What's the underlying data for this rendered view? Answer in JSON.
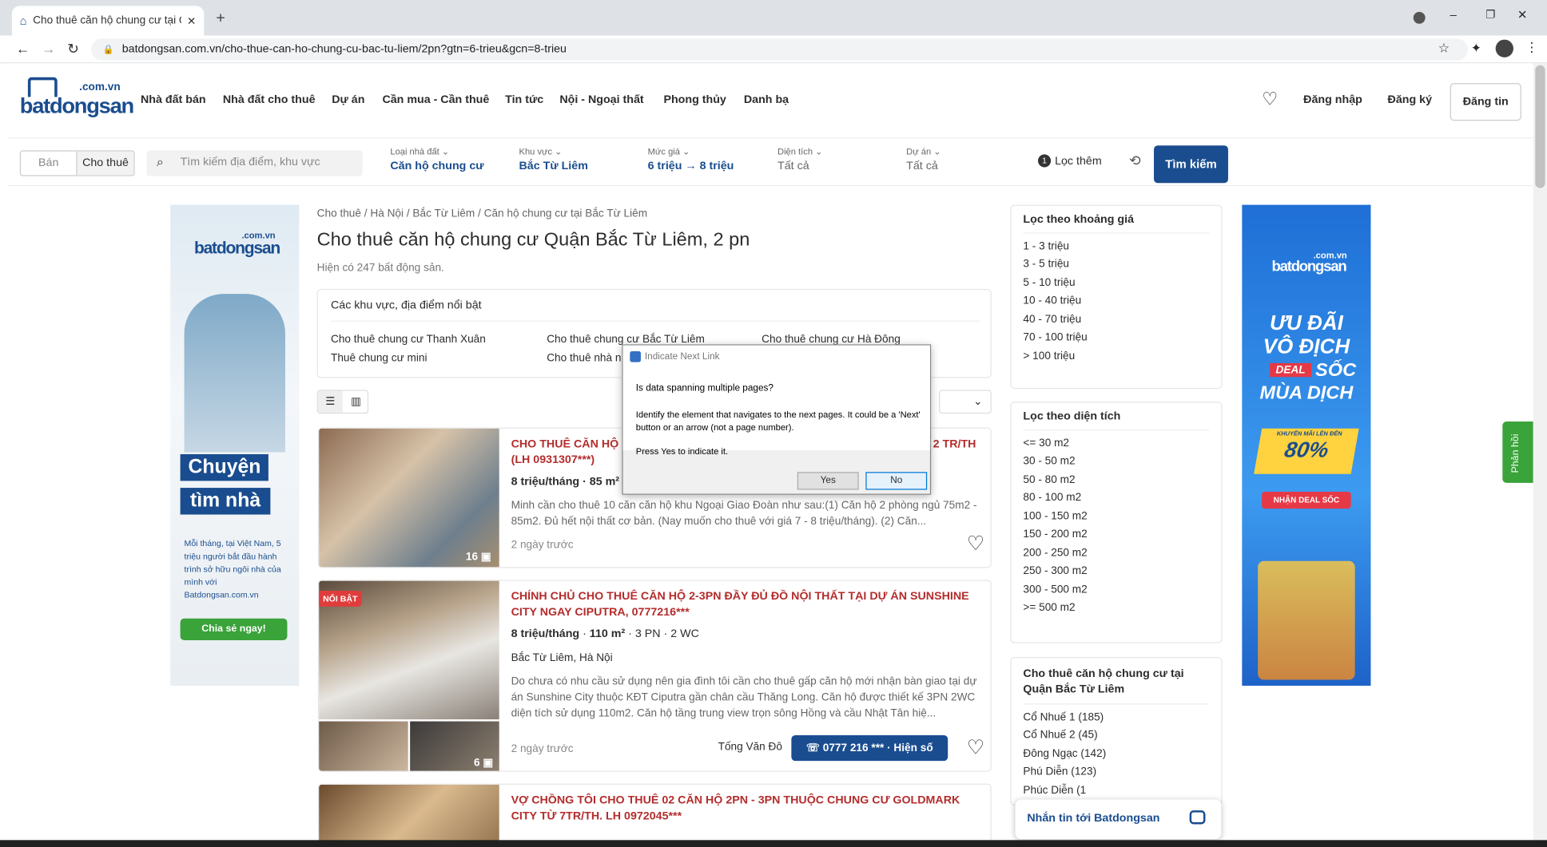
{
  "browser": {
    "tab_title": "Cho thuê căn hộ chung cư tại Qu",
    "url": "batdongsan.com.vn/cho-thue-can-ho-chung-cu-bac-tu-liem/2pn?gtn=6-trieu&gcn=8-trieu"
  },
  "logo": {
    "top": ".com.vn",
    "main": "batdongsan"
  },
  "nav": {
    "items": [
      "Nhà đất bán",
      "Nhà đất cho thuê",
      "Dự án",
      "Cần mua - Cần thuê",
      "Tin tức",
      "Nội - Ngoại thất",
      "Phong thủy",
      "Danh bạ"
    ],
    "login": "Đăng nhập",
    "register": "Đăng ký",
    "post": "Đăng tin"
  },
  "filter": {
    "sell": "Bán",
    "rent": "Cho thuê",
    "search_placeholder": "Tìm kiếm địa điểm, khu vực",
    "type_label": "Loại nhà đất",
    "type_value": "Căn hộ chung cư",
    "area_label": "Khu vực",
    "area_value": "Bắc Từ Liêm",
    "price_label": "Mức giá",
    "price_from": "6 triệu",
    "price_to": "8 triệu",
    "size_label": "Diện tích",
    "size_value": "Tất cả",
    "project_label": "Dự án",
    "project_value": "Tất cả",
    "more_count": "1",
    "more": "Lọc thêm",
    "search": "Tìm kiếm"
  },
  "breadcrumb": [
    "Cho thuê",
    "Hà Nội",
    "Bắc Từ Liêm",
    "Căn hộ chung cư tại Bắc Từ Liêm"
  ],
  "page_title": "Cho thuê căn hộ chung cư Quận Bắc Từ Liêm, 2 pn",
  "result_count": "Hiện có 247 bất động sản.",
  "featured": {
    "heading": "Các khu vực, địa điểm nổi bật",
    "links": [
      "Cho thuê chung cư Thanh Xuân",
      "Cho thuê chung cư Bắc Từ Liêm",
      "Cho thuê chung cư Hà Đông",
      "Thuê chung cư mini",
      "Cho thuê nhà n"
    ]
  },
  "left_ad": {
    "top": ".com.vn",
    "main": "batdongsan",
    "line1": "Chuyện",
    "line2": "tìm nhà",
    "body": "Mỗi tháng, tại Việt Nam, 5 triệu người bắt đầu hành trình sở hữu ngôi nhà của mình với Batdongsan.com.vn",
    "cta": "Chia sẻ ngay!"
  },
  "listings": [
    {
      "title": "CHO THUÊ CĂN HỘ DU",
      "title_tail": "2 TR/TH",
      "title2": "(LH 0931307***)",
      "price": "8 triệu/tháng",
      "area": "85 m²",
      "desc": "Minh cần cho thuê 10 căn căn hộ khu Ngoại Giao Đoàn như sau:(1) Căn hộ 2 phòng ngủ 75m2 - 85m2. Đủ hết nội thất cơ bản. (Nay muốn cho thuê với giá 7 - 8 triệu/tháng). (2) Căn...",
      "time": "2 ngày trước",
      "photos": "16"
    },
    {
      "badge": "NỔI BẬT",
      "title": "CHÍNH CHỦ CHO THUÊ CĂN HỘ 2-3PN ĐẦY ĐỦ ĐỒ NỘI THẤT TẠI DỰ ÁN SUNSHINE CITY NGAY CIPUTRA, 0777216***",
      "price": "8 triệu/tháng",
      "area": "110 m²",
      "beds": "3 PN",
      "baths": "2 WC",
      "location": "Bắc Từ Liêm, Hà Nội",
      "desc": "Do chưa có nhu cầu sử dụng nên gia đình tôi cần cho thuê gấp căn hộ mới nhận bàn giao tại dự án Sunshine City thuộc KĐT Ciputra gần chân cầu Thăng Long. Căn hộ được thiết kế 3PN 2WC diện tích sử dụng 110m2. Căn hộ tầng trung view trọn sông Hồng và cầu Nhật Tân hiệ...",
      "time": "2 ngày trước",
      "agent": "Tống Văn Đô",
      "phone": "0777 216 *** · Hiện số",
      "photos": "6"
    },
    {
      "title": "VỢ CHỒNG TÔI CHO THUÊ 02 CĂN HỘ 2PN - 3PN THUỘC CHUNG CƯ GOLDMARK CITY TỪ 7TR/TH. LH 0972045***"
    }
  ],
  "price_filter": {
    "heading": "Lọc theo khoảng giá",
    "items": [
      "1 - 3 triệu",
      "3 - 5 triệu",
      "5 - 10 triệu",
      "10 - 40 triệu",
      "40 - 70 triệu",
      "70 - 100 triệu",
      "> 100 triệu"
    ]
  },
  "area_filter": {
    "heading": "Lọc theo diện tích",
    "items": [
      "<= 30 m2",
      "30 - 50 m2",
      "50 - 80 m2",
      "80 - 100 m2",
      "100 - 150 m2",
      "150 - 200 m2",
      "200 - 250 m2",
      "250 - 300 m2",
      "300 - 500 m2",
      ">= 500 m2"
    ]
  },
  "district": {
    "heading": "Cho thuê căn hộ chung cư tại Quận Bắc Từ Liêm",
    "items": [
      "Cổ Nhuế 1 (185)",
      "Cổ Nhuế 2 (45)",
      "Đông Ngạc (142)",
      "Phú Diễn (123)",
      "Phúc Diễn (1"
    ]
  },
  "right_ad": {
    "top": ".com.vn",
    "main": "batdongsan",
    "l1": "ƯU ĐÃI",
    "l2": "VÔ ĐỊCH",
    "deal": "DEAL",
    "soc": "SỐC",
    "l3": "MÙA DỊCH",
    "promo_small": "KHUYẾN MÃI LÊN ĐẾN",
    "pct": "80%",
    "cta": "NHẬN DEAL SỐC"
  },
  "feedback": "Phản hồi",
  "chat": "Nhắn tin tới Batdongsan",
  "dialog": {
    "title": "Indicate Next Link",
    "question": "Is data spanning multiple pages?",
    "line1": "Identify the element that navigates to the next pages. It could be a 'Next' button or an arrow (not a page number).",
    "line2": "Press Yes to indicate it.",
    "yes": "Yes",
    "no": "No"
  },
  "colors": {
    "brand": "#1a4d8f",
    "accent": "#c81e1e",
    "dialog_bg": "#f0f0f0"
  }
}
